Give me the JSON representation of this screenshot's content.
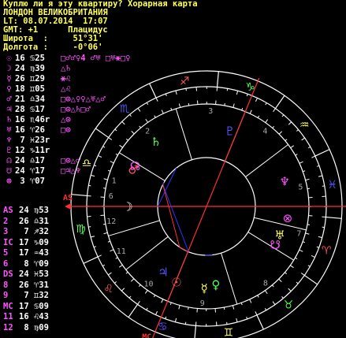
{
  "header": {
    "line1": "Куплю ли я эту квартиру? Хорарная карта",
    "line2": "ЛОНДОН ВЕЛИКОБРИТАНИЯ",
    "line3": "LT: 08.07.2014  17:07",
    "line4": "GMT: +1      Плацидус",
    "line5": "Широта  :     51°31'",
    "line6": "Долгота :     -0°06'"
  },
  "planets": [
    {
      "glyph": "☉",
      "color": "#ff55ff",
      "pos": "16 ♋25",
      "aspects": "□♂♂♀4 ♂♅ □♅⚹□♀"
    },
    {
      "glyph": "☽",
      "color": "#ff55ff",
      "pos": "24 ♍39",
      "aspects": "△♄"
    },
    {
      "glyph": "☿",
      "color": "#ff55ff",
      "pos": "26 ♊29",
      "aspects": "⚹♌"
    },
    {
      "glyph": "♀",
      "color": "#ff55ff",
      "pos": "18 ♊05",
      "aspects": "△♌"
    },
    {
      "glyph": "♂",
      "color": "#ff55ff",
      "pos": "21 ♎34",
      "aspects": "□⊙△♀♀△♅△♂"
    },
    {
      "glyph": "♃",
      "color": "#ff55ff",
      "pos": "28 ♋17",
      "aspects": "□⊙△♄□♂"
    },
    {
      "glyph": "♄",
      "color": "#ff55ff",
      "pos": "16 ♏46r",
      "aspects": "△⊙"
    },
    {
      "glyph": "♅",
      "color": "#ff55ff",
      "pos": "16 ♈26",
      "aspects": "□⊙"
    },
    {
      "glyph": "♆",
      "color": "#ff55ff",
      "pos": " 7 ♓23r",
      "aspects": ""
    },
    {
      "glyph": "♇",
      "color": "#ff55ff",
      "pos": "12 ♑11r",
      "aspects": ""
    },
    {
      "glyph": "☊",
      "color": "#ff55ff",
      "pos": "24 ♎17",
      "aspects": "□⊙△♂"
    },
    {
      "glyph": "☋",
      "color": "#ff55ff",
      "pos": "24 ♈17",
      "aspects": "□♃△♆"
    },
    {
      "glyph": "⊗",
      "color": "#ff55ff",
      "pos": " 3 ♈07",
      "aspects": ""
    }
  ],
  "houses": [
    {
      "label": "AS",
      "pos": "24 ♍53"
    },
    {
      "label": "2",
      "pos": "26 ♎31"
    },
    {
      "label": "3",
      "pos": " 7 ♐32"
    },
    {
      "label": "IC",
      "pos": "17 ♑09"
    },
    {
      "label": "5",
      "pos": "17 ♒43"
    },
    {
      "label": "6",
      "pos": " 8 ♈09"
    },
    {
      "label": "DS",
      "pos": "24 ♓53"
    },
    {
      "label": "8",
      "pos": "26 ♈31"
    },
    {
      "label": "9",
      "pos": " 7 ♊32"
    },
    {
      "label": "MC",
      "pos": "17 ♋09"
    },
    {
      "label": "11",
      "pos": "16 ♌43"
    },
    {
      "label": "12",
      "pos": " 8 ♍09"
    }
  ],
  "wheel": {
    "mc_label": "MC",
    "as_label": "AS",
    "house_numbers": [
      "1",
      "2",
      "3",
      "4",
      "5",
      "6",
      "7",
      "8",
      "9",
      "10",
      "11",
      "12"
    ],
    "signs": [
      "♈",
      "♉",
      "♊",
      "♋",
      "♌",
      "♍",
      "♎",
      "♏",
      "♐",
      "♑",
      "♒",
      "♓"
    ],
    "sign_colors": [
      "#ff5555",
      "#55ff55",
      "#ffff55",
      "#5555ff",
      "#ff5555",
      "#55ff55",
      "#ffff55",
      "#5555ff",
      "#ff5555",
      "#55ff55",
      "#ffff55",
      "#5555ff"
    ]
  },
  "colors": {
    "header": "#ffff55",
    "accent": "#ff55ff",
    "ring": "#ffffff",
    "red": "#ff3030",
    "blue": "#3030ff"
  }
}
